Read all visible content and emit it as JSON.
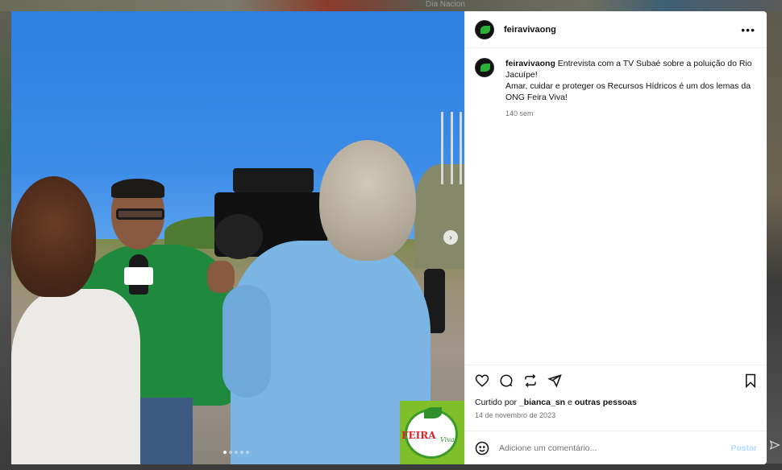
{
  "backdrop": {
    "top_text": "Dia Nacion"
  },
  "post": {
    "username": "feiravivaong",
    "caption_line1": "Entrevista com a TV Subaé sobre a poluição do Rio Jacuípe!",
    "caption_line2": "Amar, cuidar e proteger os Recursos Hídricos é um dos lemas da ONG Feira Viva!",
    "caption_time": "140 sem",
    "liked_by_prefix": "Curtido por ",
    "liked_by_user": "_bianca_sn",
    "liked_by_suffix": " e ",
    "liked_by_others": "outras pessoas",
    "date": "14 de novembro de 2023",
    "more_label": "•••"
  },
  "photo": {
    "next_label": "›",
    "carousel_total": 5,
    "carousel_active": 1,
    "logo_text": "FEIRA",
    "logo_text2": "Viva"
  },
  "comment": {
    "placeholder": "Adicione um comentário...",
    "post_label": "Postar"
  },
  "icons": {
    "like": "heart-icon",
    "comment": "comment-icon",
    "repost": "repost-icon",
    "share": "share-icon",
    "save": "bookmark-icon",
    "emoji": "emoji-icon"
  },
  "colors": {
    "post_button": "#b3dbff",
    "secondary_text": "#737373",
    "accent_green": "#2bb03a"
  }
}
